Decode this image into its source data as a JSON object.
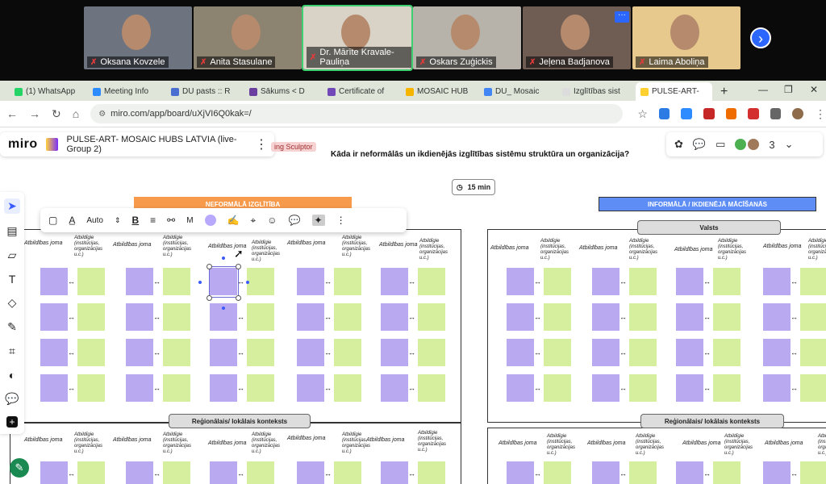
{
  "zoom": {
    "participants": [
      {
        "name": "Oksana Kovzele",
        "bg": "#6d7480",
        "active": false
      },
      {
        "name": "Anita Stasulane",
        "bg": "#8c8370",
        "active": false
      },
      {
        "name": "Dr. Mārīte Kravale-Pauliņa",
        "bg": "#d8d3c6",
        "active": true
      },
      {
        "name": "Oskars Zuģickis",
        "bg": "#b8b3aa",
        "active": false
      },
      {
        "name": "Jeļena Badjanova",
        "bg": "#6f5d54",
        "active": false
      },
      {
        "name": "Laima Aboliņa",
        "bg": "#e7c98d",
        "active": false
      }
    ],
    "more_label": "···",
    "next_label": "›"
  },
  "browser": {
    "tabs": [
      {
        "label": "(1) WhatsApp",
        "color": "#25d366"
      },
      {
        "label": "Meeting Info",
        "color": "#2d8cff"
      },
      {
        "label": "DU pasts :: R",
        "color": "#4a6fd1"
      },
      {
        "label": "Sākums < D",
        "color": "#6b3fa0"
      },
      {
        "label": "Certificate of",
        "color": "#7248b9"
      },
      {
        "label": "MOSAIC HUB",
        "color": "#f4b400"
      },
      {
        "label": "DU_ Mosaic",
        "color": "#4285f4"
      },
      {
        "label": "Izglītības sist",
        "color": "#dcdcdc"
      },
      {
        "label": "PULSE-ART-",
        "color": "#ffd02f"
      }
    ],
    "new_tab": "+",
    "url": "miro.com/app/board/uXjVI6Q0kak=/",
    "win_min": "—",
    "win_max": "❐",
    "win_close": "✕"
  },
  "miro": {
    "logo": "miro",
    "board_title": "PULSE-ART- MOSAIC HUBS LATVIA (live-Group 2)",
    "menu": "⋮",
    "user_count": "3",
    "question": "Kāda ir neformālās un ikdienējās izglītības sistēmu struktūra un organizācija?",
    "sculptor_tag": "ing Sculptor",
    "timer": "15 min",
    "toolbar": {
      "font_mode": "Auto",
      "size": "M"
    },
    "section_left": "NEFORMĀLĀ IZGLĪTĪBA",
    "section_right": "INFORMĀLĀ / IKDIENĒJĀ MĀCĪŠANĀS",
    "country_pill": "Valsts",
    "regional_pill": "Reģionālais/ lokālais konteksts",
    "col_area": "Atbildības joma",
    "col_inst": "Atbildīgie (institūcijas, organizācijas u.c.)",
    "col_inst_short": "Atbildīgie",
    "colors": {
      "purple_note": "#b8a9f0",
      "green_note": "#d6ef9f",
      "orange": "#f79a4b",
      "blue": "#5e8ef5"
    }
  }
}
